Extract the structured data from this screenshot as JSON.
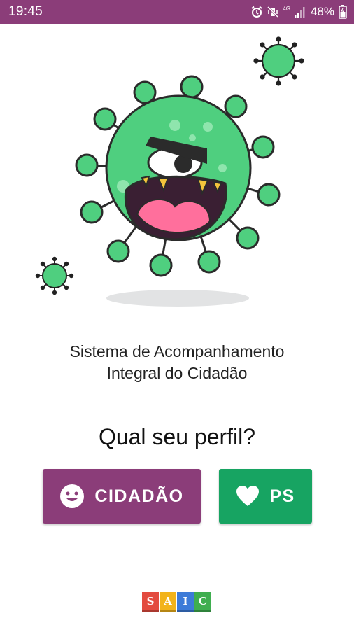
{
  "status_bar": {
    "time": "19:45",
    "network_label": "4G",
    "battery": "48%",
    "icons": [
      "alarm-icon",
      "vibrate-mute-icon",
      "signal-icon",
      "battery-icon"
    ],
    "color": "#8b3d79"
  },
  "hero": {
    "illustration": "virus-monster-icon",
    "virus_color": "#4fcf7f",
    "mouth_color": "#3a1f33",
    "tongue_color": "#ff6f9c"
  },
  "subtitle": {
    "line1": "Sistema de Acompanhamento",
    "line2": "Integral do Cidadão"
  },
  "question": "Qual seu perfil?",
  "buttons": {
    "cidadao": {
      "label": "CIDADÃO",
      "icon": "smiley-face-icon",
      "color": "#8b3d79"
    },
    "ps": {
      "label": "PS",
      "icon": "heart-icon",
      "color": "#17a462"
    }
  },
  "logo": {
    "letters": [
      "S",
      "A",
      "I",
      "C"
    ],
    "colors": [
      "#e34b3f",
      "#f2b31b",
      "#3d7bd8",
      "#3fae4f"
    ]
  }
}
